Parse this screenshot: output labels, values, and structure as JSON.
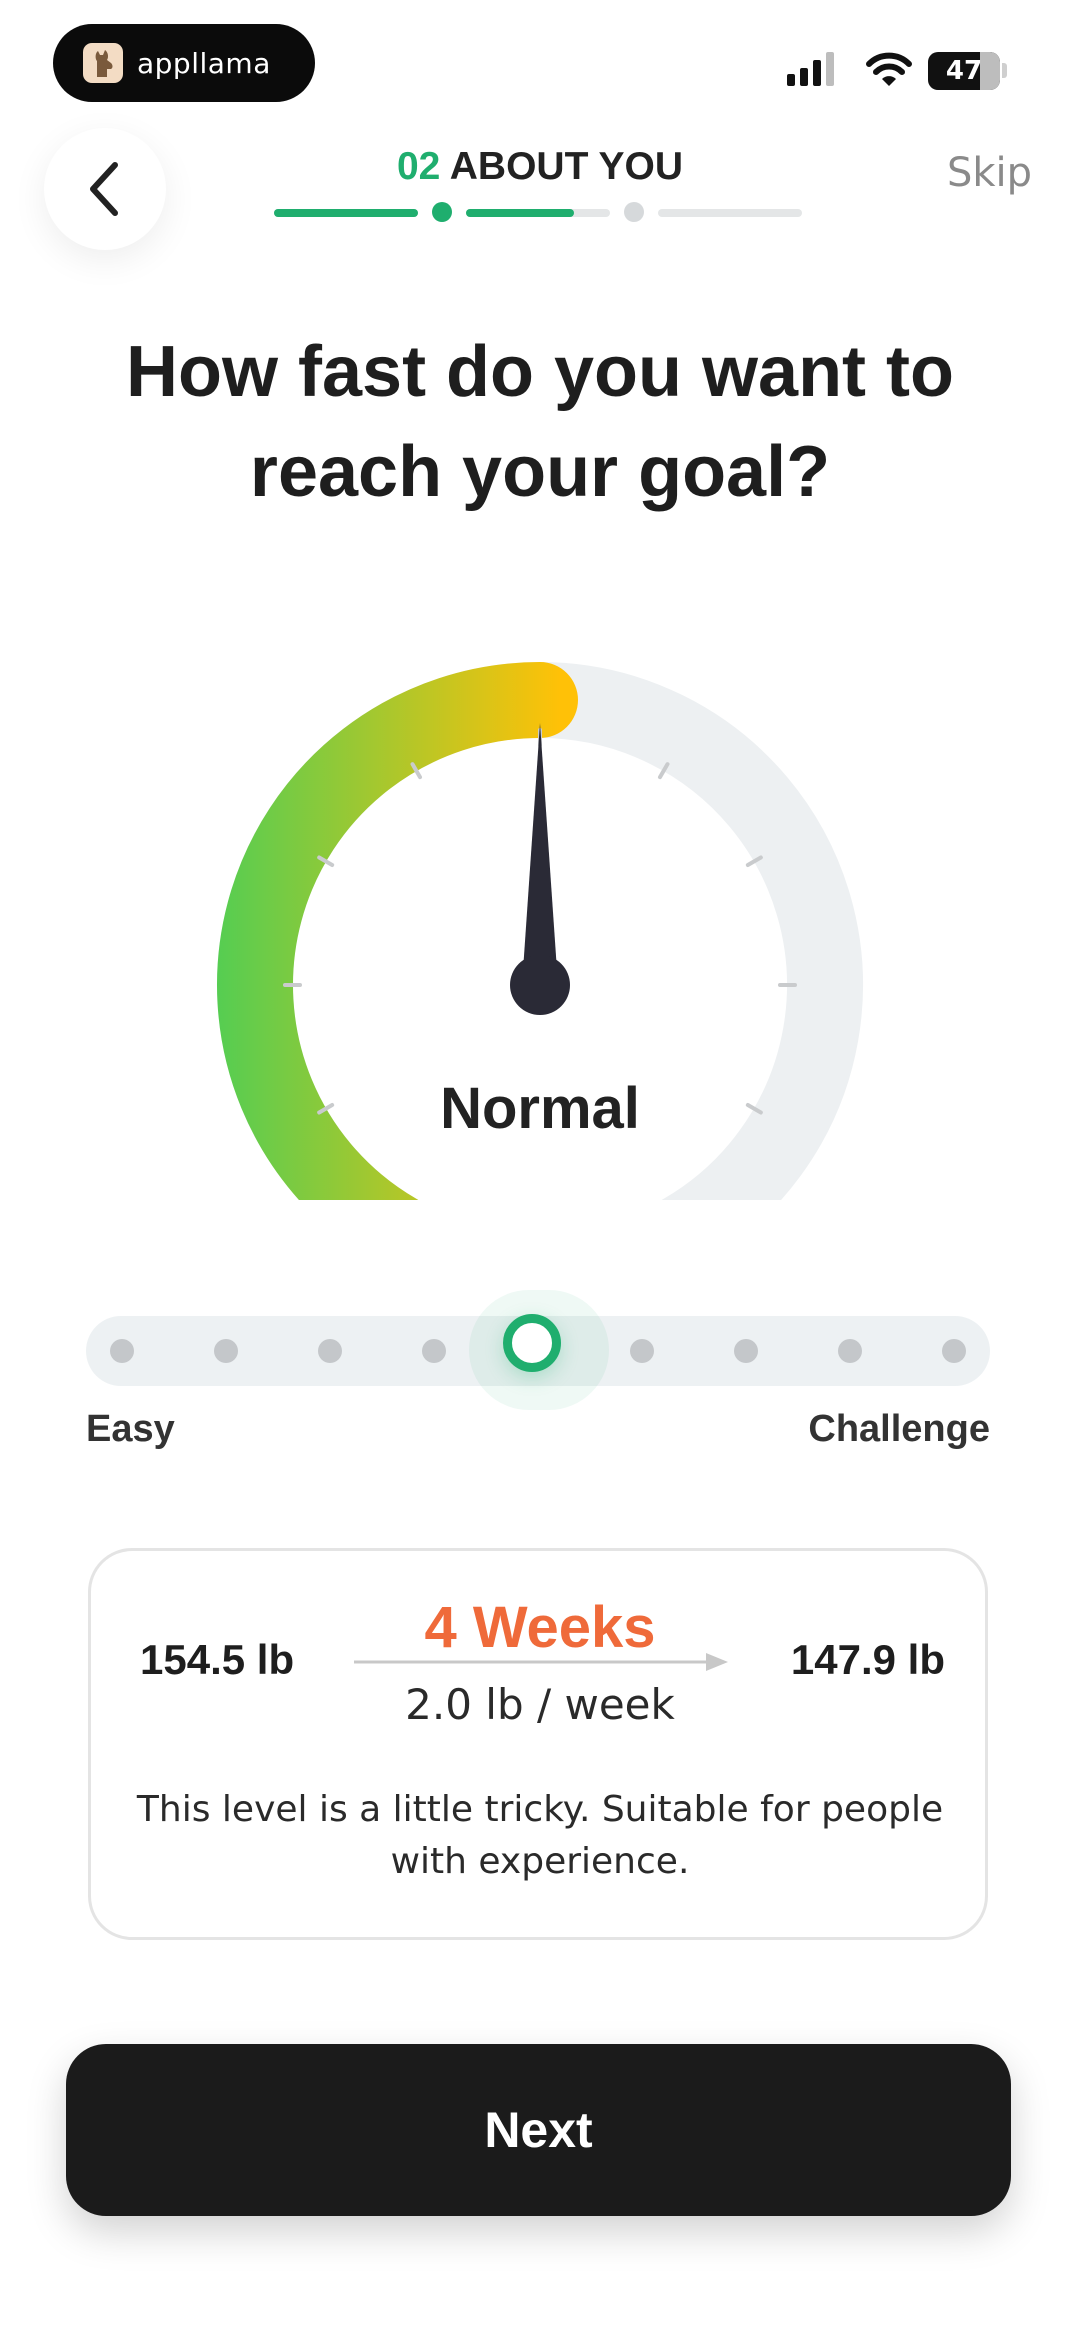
{
  "status_bar": {
    "app_pill_label": "appllama",
    "battery_level": "47"
  },
  "header": {
    "step_number": "02",
    "step_title": "ABOUT YOU",
    "skip_label": "Skip"
  },
  "progress": {
    "segment_1_fill": 1.0,
    "segment_2_fill": 0.75,
    "segment_3_fill": 0.0
  },
  "question": {
    "line1": "How fast do you want to",
    "line2": "reach your goal?"
  },
  "gauge": {
    "label": "Normal",
    "level": 0.5,
    "colors": {
      "start": "#3ecf5c",
      "end": "#ffc107",
      "track": "#edf0f2",
      "needle": "#2a2a36"
    }
  },
  "slider": {
    "stops": 9,
    "selected_index": 4,
    "min_label": "Easy",
    "max_label": "Challenge",
    "accent": "#1fae6e"
  },
  "result": {
    "start_weight": "154.5 lb",
    "end_weight": "147.9 lb",
    "duration": "4 Weeks",
    "rate": "2.0 lb / week",
    "description": "This level is a little tricky. Suitable for people with experience.",
    "duration_color": "#ef6a3a"
  },
  "footer": {
    "next_label": "Next"
  }
}
